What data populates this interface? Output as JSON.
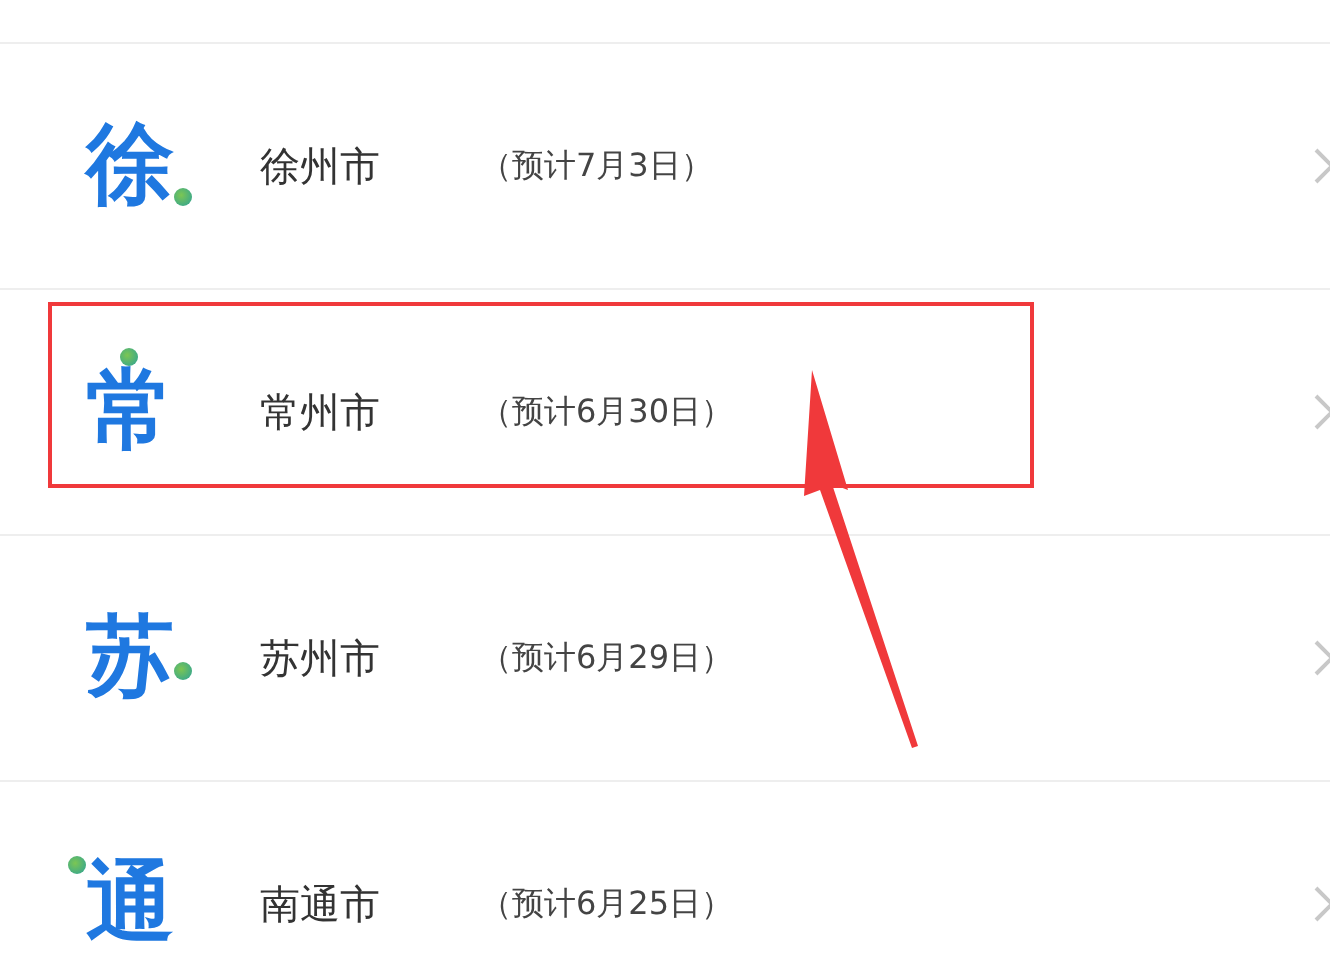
{
  "cities": [
    {
      "kind": "lowdot",
      "badge": "徐",
      "name": "徐州市",
      "date": "（预计7月3日）",
      "highlighted": false
    },
    {
      "kind": "topdot",
      "badge": "常",
      "name": "常州市",
      "date": "（预计6月30日）",
      "highlighted": true
    },
    {
      "kind": "sidedot",
      "badge": "苏",
      "name": "苏州市",
      "date": "（预计6月29日）",
      "highlighted": false
    },
    {
      "kind": "leftdot",
      "badge": "通",
      "name": "南通市",
      "date": "（预计6月25日）",
      "highlighted": false
    }
  ]
}
